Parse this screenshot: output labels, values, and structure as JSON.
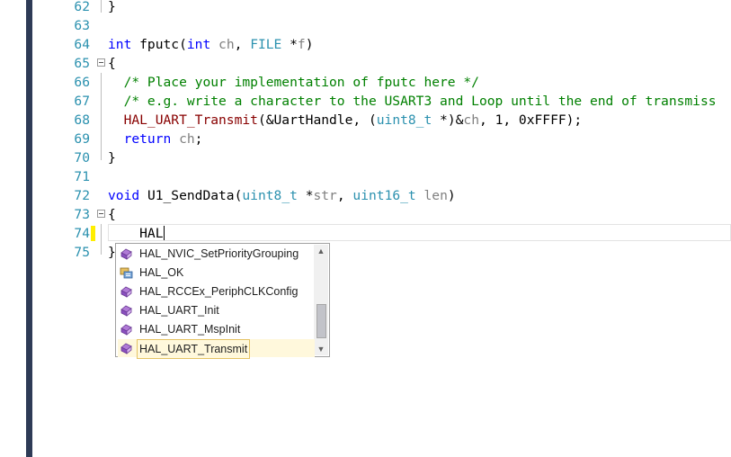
{
  "editor": {
    "lines": [
      {
        "num": "62",
        "code": "}",
        "tokens": [
          [
            "}",
            ""
          ]
        ]
      },
      {
        "num": "63",
        "tokens": []
      },
      {
        "num": "64",
        "tokens": [
          [
            "int",
            "kw"
          ],
          [
            " fputc(",
            ""
          ],
          [
            "int",
            "kw"
          ],
          [
            " ",
            ""
          ],
          [
            "ch",
            "pm"
          ],
          [
            ", ",
            ""
          ],
          [
            "FILE",
            "ty"
          ],
          [
            " *",
            ""
          ],
          [
            "f",
            "pm"
          ],
          [
            ")",
            ""
          ]
        ]
      },
      {
        "num": "65",
        "fold": true,
        "tokens": [
          [
            "{",
            ""
          ]
        ]
      },
      {
        "num": "66",
        "tokens": [
          [
            "  ",
            ""
          ],
          [
            "/* Place your implementation of fputc here */",
            "cm"
          ]
        ]
      },
      {
        "num": "67",
        "tokens": [
          [
            "  ",
            ""
          ],
          [
            "/* e.g. write a character to the USART3 and Loop until the end of transmiss",
            "cm"
          ]
        ]
      },
      {
        "num": "68",
        "tokens": [
          [
            "  ",
            ""
          ],
          [
            "HAL_UART_Transmit",
            "fn"
          ],
          [
            "(&UartHandle, (",
            ""
          ],
          [
            "uint8_t",
            "ty"
          ],
          [
            " *)&",
            ""
          ],
          [
            "ch",
            "pm"
          ],
          [
            ", 1, 0xFFFF);",
            ""
          ]
        ]
      },
      {
        "num": "69",
        "tokens": [
          [
            "  ",
            ""
          ],
          [
            "return",
            "kw"
          ],
          [
            " ",
            ""
          ],
          [
            "ch",
            "pm"
          ],
          [
            ";",
            ""
          ]
        ]
      },
      {
        "num": "70",
        "tokens": [
          [
            "}",
            ""
          ]
        ]
      },
      {
        "num": "71",
        "tokens": []
      },
      {
        "num": "72",
        "tokens": [
          [
            "void",
            "kw"
          ],
          [
            " U1_SendData(",
            ""
          ],
          [
            "uint8_t",
            "ty"
          ],
          [
            " *",
            ""
          ],
          [
            "str",
            "pm"
          ],
          [
            ", ",
            ""
          ],
          [
            "uint16_t",
            "ty"
          ],
          [
            " ",
            ""
          ],
          [
            "len",
            "pm"
          ],
          [
            ")",
            ""
          ]
        ]
      },
      {
        "num": "73",
        "fold": true,
        "tokens": [
          [
            "{",
            ""
          ]
        ]
      },
      {
        "num": "74",
        "current": true,
        "typed": "    HAL",
        "tokens": []
      },
      {
        "num": "75",
        "tokens": [
          [
            "}",
            ""
          ]
        ]
      }
    ]
  },
  "autocomplete": {
    "items": [
      {
        "label": "HAL_NVIC_SetPriorityGrouping",
        "icon": "function-icon"
      },
      {
        "label": "HAL_OK",
        "icon": "enum-member-icon"
      },
      {
        "label": "HAL_RCCEx_PeriphCLKConfig",
        "icon": "function-icon"
      },
      {
        "label": "HAL_UART_Init",
        "icon": "function-icon"
      },
      {
        "label": "HAL_UART_MspInit",
        "icon": "function-icon"
      },
      {
        "label": "HAL_UART_Transmit",
        "icon": "function-icon",
        "selected": true
      }
    ],
    "scroll_up_glyph": "▲",
    "scroll_down_glyph": "▼"
  },
  "colors": {
    "line_number": "#2b91af",
    "keyword": "#0000ff",
    "type": "#2b91af",
    "comment": "#008000",
    "function": "#880000",
    "parameter": "#808080",
    "change_marker": "#ffee00",
    "selection": "#fff8dc"
  }
}
